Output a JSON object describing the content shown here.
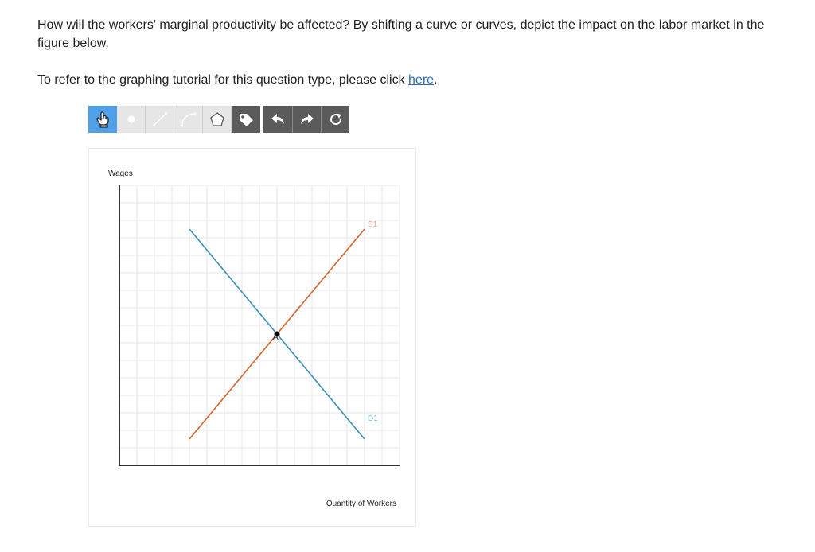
{
  "question": {
    "text": "How will the workers' marginal productivity be affected? By shifting a curve or curves, depict the impact on the labor market in the figure below."
  },
  "tutorial": {
    "prefix": "To refer to the graphing tutorial for this question type, please click ",
    "link_text": "here",
    "suffix": "."
  },
  "toolbar": {
    "tools": [
      {
        "name": "select-tool",
        "icon": "pointer-hand-icon",
        "active": true
      },
      {
        "name": "point-tool",
        "icon": "dot-icon"
      },
      {
        "name": "line-tool",
        "icon": "line-icon"
      },
      {
        "name": "curve-tool",
        "icon": "curve-icon"
      },
      {
        "name": "polygon-tool",
        "icon": "polygon-icon"
      },
      {
        "name": "label-tool",
        "icon": "tag-icon"
      },
      {
        "name": "undo-button",
        "icon": "undo-arrow-icon"
      },
      {
        "name": "redo-button",
        "icon": "redo-arrow-icon"
      },
      {
        "name": "reset-button",
        "icon": "reset-icon"
      }
    ]
  },
  "graph": {
    "y_axis_label": "Wages",
    "x_axis_label": "Quantity of Workers",
    "supply_label": "S1",
    "demand_label": "D1",
    "point_label": "A",
    "colors": {
      "supply": "#d2642b",
      "demand": "#3a8db5",
      "supply_label": "#e8a98d",
      "demand_label": "#7fb8d6",
      "grid": "#e6e6e6",
      "axis": "#333333",
      "point": "#000000"
    }
  },
  "chart_data": {
    "type": "line",
    "xlabel": "Quantity of Workers",
    "ylabel": "Wages",
    "xlim": [
      0,
      16
    ],
    "ylim": [
      0,
      16
    ],
    "series": [
      {
        "name": "S1",
        "x": [
          4,
          14
        ],
        "y": [
          1.5,
          13.5
        ]
      },
      {
        "name": "D1",
        "x": [
          4,
          14
        ],
        "y": [
          13.5,
          1.5
        ]
      }
    ],
    "points": [
      {
        "label": "A",
        "x": 9,
        "y": 7.5
      }
    ],
    "grid": true
  }
}
